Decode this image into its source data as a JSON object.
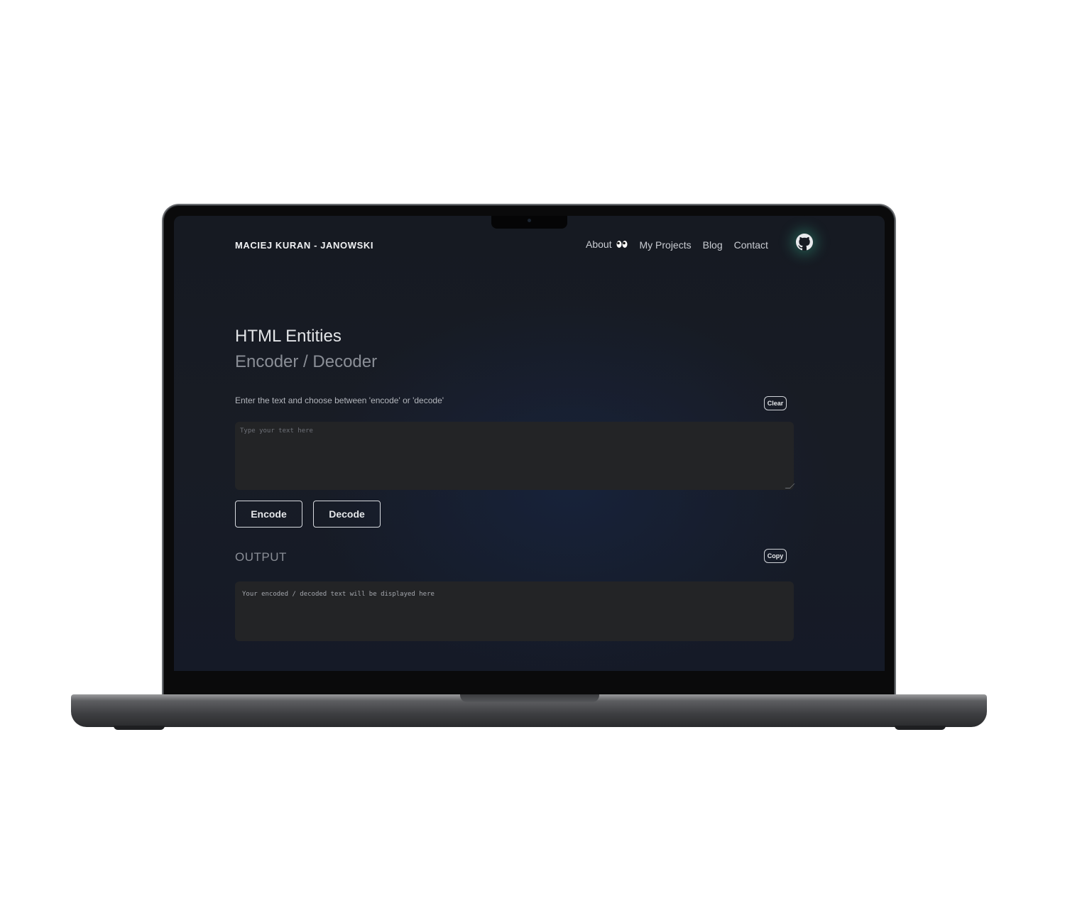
{
  "site": {
    "brand": "MACIEJ KURAN - JANOWSKI"
  },
  "nav": {
    "items": [
      {
        "label": "About",
        "icon": "eyes-emoji"
      },
      {
        "label": "My Projects"
      },
      {
        "label": "Blog"
      },
      {
        "label": "Contact"
      }
    ],
    "github_icon": "github-icon"
  },
  "header": {
    "title": "HTML Entities",
    "subtitle": "Encoder / Decoder"
  },
  "input": {
    "hint": "Enter the text and choose between 'encode' or 'decode'",
    "clear_label": "Clear",
    "placeholder": "Type your text here"
  },
  "actions": {
    "encode_label": "Encode",
    "decode_label": "Decode"
  },
  "output": {
    "label": "OUTPUT",
    "copy_label": "Copy",
    "placeholder": "Your encoded / decoded text will be displayed here"
  },
  "colors": {
    "background": "#161a22",
    "text_primary": "#e3e5e8",
    "text_muted": "#8a8e96",
    "field_bg": "#232426",
    "github_glow": "#38be96"
  }
}
